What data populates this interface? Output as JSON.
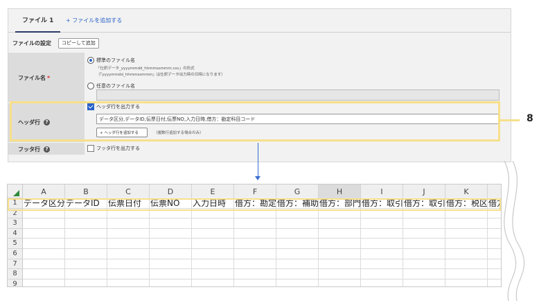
{
  "tabs": {
    "active_label": "ファイル 1",
    "add_label": "+ ファイルを追加する"
  },
  "settings": {
    "title": "ファイルの設定",
    "copy_button": "コピーして追加"
  },
  "filename": {
    "label": "ファイル名",
    "required_mark": "*",
    "standard_option": "標準のファイル名",
    "standard_note1": "「仕訳データ_yyyymmdd_hhmmssmmm.csv」の形式",
    "standard_note2": "（「yyyymmdd_hhmmssmmm」は仕訳データ出力時の日時になります）",
    "custom_option": "任意のファイル名",
    "custom_value": ""
  },
  "header_row": {
    "label": "ヘッダ行",
    "help": "?",
    "checkbox_label": "ヘッダ行を出力する",
    "checked": true,
    "value": "データ区分,データID,伝票日付,伝票NO,入力日時,借方：勘定科目コード",
    "add_button": "+ ヘッダ行を追加する",
    "add_note": "（複数行追加する場合のみ）"
  },
  "footer_row": {
    "label": "フッタ行",
    "help": "?",
    "checkbox_label": "フッタ行を出力する",
    "checked": false
  },
  "callout_number": "8",
  "spreadsheet": {
    "columns": [
      "A",
      "B",
      "C",
      "D",
      "E",
      "F",
      "G",
      "H",
      "I",
      "J",
      "K",
      ""
    ],
    "selected_column": "H",
    "rows": [
      "1",
      "2",
      "3",
      "4",
      "5",
      "6",
      "7",
      "8",
      "9"
    ],
    "row1": [
      "データ区分",
      "データID",
      "伝票日付",
      "伝票NO",
      "入力日時",
      "借方：勘定科目",
      "借方：補助科目",
      "借方：部門",
      "借方：取引先",
      "借方：取引先",
      "借方：税区分",
      "借方：税"
    ]
  },
  "colors": {
    "accent": "#2a62c9",
    "highlight": "#f7e08a",
    "tab_underline": "#2b3a67"
  }
}
